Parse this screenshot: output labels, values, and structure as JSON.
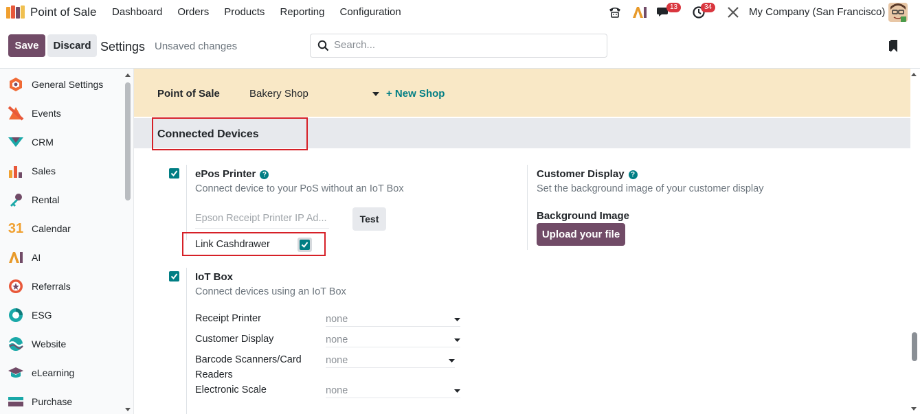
{
  "navbar": {
    "app_name": "Point of Sale",
    "menu": [
      "Dashboard",
      "Orders",
      "Products",
      "Reporting",
      "Configuration"
    ],
    "messages_badge": "13",
    "activities_badge": "34",
    "ai_label": "AI",
    "company": "My Company (San Francisco)"
  },
  "control": {
    "save_label": "Save",
    "discard_label": "Discard",
    "breadcrumb": "Settings",
    "status": "Unsaved changes",
    "search_placeholder": "Search..."
  },
  "sidebar": {
    "items": [
      {
        "label": "General Settings",
        "icon": "general-settings-icon",
        "color": "#f06a35"
      },
      {
        "label": "Events",
        "icon": "events-icon",
        "color": "#f06a35"
      },
      {
        "label": "CRM",
        "icon": "crm-icon",
        "color": "#1aa8a8"
      },
      {
        "label": "Sales",
        "icon": "sales-icon",
        "color": "#e8583a"
      },
      {
        "label": "Rental",
        "icon": "rental-icon",
        "color": "#1aa8a8"
      },
      {
        "label": "Calendar",
        "icon": "calendar-icon",
        "color": "#f0a030"
      },
      {
        "label": "AI",
        "icon": "ai-icon",
        "color": "#e89a2a"
      },
      {
        "label": "Referrals",
        "icon": "referrals-icon",
        "color": "#e8583a"
      },
      {
        "label": "ESG",
        "icon": "esg-icon",
        "color": "#1aa8a8"
      },
      {
        "label": "Website",
        "icon": "website-icon",
        "color": "#1aa8a8"
      },
      {
        "label": "eLearning",
        "icon": "elearning-icon",
        "color": "#714b67"
      },
      {
        "label": "Purchase",
        "icon": "purchase-icon",
        "color": "#1aa8a8"
      }
    ],
    "calendar_number": "31"
  },
  "settings": {
    "pos_label": "Point of Sale",
    "pos_value": "Bakery Shop",
    "new_shop": "+ New Shop",
    "section_title": "Connected Devices",
    "epos": {
      "title": "ePos Printer",
      "help": "?",
      "desc": "Connect device to your PoS without an IoT Box",
      "ip_placeholder": "Epson Receipt Printer IP Ad...",
      "test_label": "Test",
      "link_label": "Link Cashdrawer",
      "checked": true
    },
    "customer_display": {
      "title": "Customer Display",
      "help": "?",
      "desc": "Set the background image of your customer display",
      "bg_label": "Background Image",
      "upload_label": "Upload your file"
    },
    "iot": {
      "title": "IoT Box",
      "desc": "Connect devices using an IoT Box",
      "checked": true,
      "rows": [
        {
          "label": "Receipt Printer",
          "value": "none"
        },
        {
          "label": "Customer Display",
          "value": "none"
        },
        {
          "label": "Barcode Scanners/Card",
          "label2": "Readers",
          "value": "none"
        },
        {
          "label": "Electronic Scale",
          "value": "none"
        }
      ]
    }
  },
  "colors": {
    "brand": "#714b67",
    "accent": "#017e84",
    "highlight_box": "#d62027",
    "pos_band": "#f9e8c6"
  }
}
